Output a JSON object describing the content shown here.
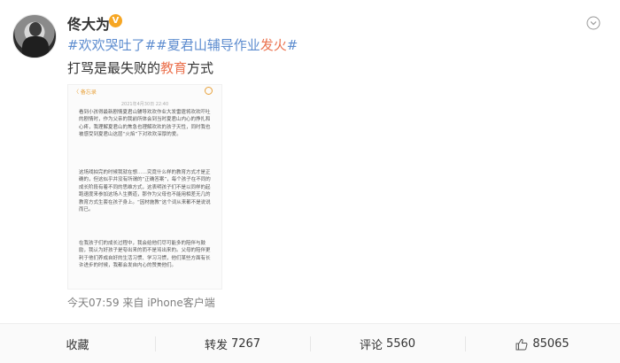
{
  "post": {
    "username": "佟大为",
    "verified_badge": "V",
    "topics": {
      "t1_prefix": "#",
      "t1": "欢欢哭吐了",
      "t1_suffix": "#",
      "t2_prefix": "#",
      "t2_a": "夏君山辅导作业",
      "t2_b": "发火",
      "t2_suffix": "#"
    },
    "headline": {
      "part1": "打骂是最失败的",
      "highlight": "教育",
      "part2": "方式"
    },
    "meta": "今天07:59  来自 iPhone客户端",
    "image": {
      "back_label": "〈 备忘录",
      "date": "2021年4月30日 22:40",
      "para1": "看到小孩得最新剧情夏君山辅导欢欢作业大发雷霆将欢欢吓吐的剧情时，作为父亲的我前所体会到当时夏君山内心的挣扎和心疼，我理解夏君山的焦急也理解欢欢的孩子天性，同时我也被感受到夏君山这层“火焰”下对欢欢深厚的爱。",
      "para2": "这场戏拍完的时候我就在想……究竟什么样的教育方式才是正确的，但这似乎并没有所谓的“正确答案”，每个孩子在不同的成长阶段有着不同的思维方式，这表明孩子们不是以同样的起跑速度来参加这场人生赛道，那作为父母也不能用相差无几的教育方式生套在孩子身上。“因材施教”这个词从来都不是说说而已。",
      "para3": "在我孩子们的成长过程中，我会给他们尽可能多的陪伴与鼓励，我认为好孩子是夸出来的而不是骂出来的。父母的陪伴更利于他们养成自好的生活习惯、学习习惯，他们某些方面有长许进步的时候，我都会发自内心的赞美他们。"
    }
  },
  "footer": {
    "favorite": "收藏",
    "repost_label": "转发",
    "repost_count": "7267",
    "comment_label": "评论",
    "comment_count": "5560",
    "like_count": "85065"
  },
  "colors": {
    "topic_orange": "#eb7350",
    "topic_blue": "#5d8ccf",
    "verified_gold": "#f6a623",
    "meta_gray": "#808080"
  },
  "icons": [
    "more-chevron-icon",
    "verified-badge-icon",
    "like-thumb-icon"
  ]
}
